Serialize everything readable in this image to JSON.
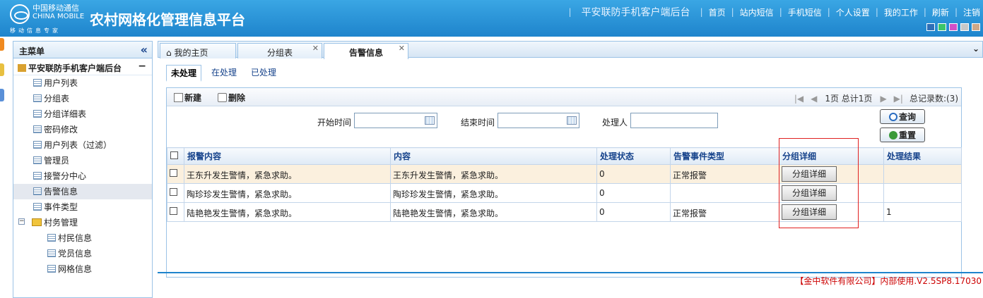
{
  "header": {
    "logo_cn": "中国移动通信",
    "logo_en": "CHINA MOBILE",
    "logo_slogan": "移动信息专家",
    "title": "农村网格化管理信息平台",
    "system_name": "平安联防手机客户端后台",
    "nav": [
      "首页",
      "站内短信",
      "手机短信",
      "个人设置",
      "我的工作",
      "刷新",
      "注销"
    ],
    "theme_colors": [
      "#2f6fb7",
      "#3bc56a",
      "#d050c8",
      "#c8c8c8",
      "#cfa888"
    ]
  },
  "sidebar": {
    "title": "主菜单",
    "collapse_icon": "«",
    "root": "平安联防手机客户端后台",
    "items": [
      "用户列表",
      "分组表",
      "分组详细表",
      "密码修改",
      "用户列表（过滤）",
      "管理员",
      "接警分中心",
      "告警信息",
      "事件类型"
    ],
    "folder": "村务管理",
    "sub_items": [
      "村民信息",
      "党员信息",
      "网格信息"
    ]
  },
  "tabs": [
    {
      "label": "我的主页"
    },
    {
      "label": "分组表"
    },
    {
      "label": "告警信息"
    }
  ],
  "subtabs": [
    "未处理",
    "在处理",
    "已处理"
  ],
  "toolbar": {
    "new": "新建",
    "delete": "删除",
    "pager_text": "1页 总计1页",
    "total": "总记录数:(3)"
  },
  "search": {
    "start_label": "开始时间",
    "end_label": "结束时间",
    "handler_label": "处理人",
    "query": "查询",
    "reset": "重置"
  },
  "table": {
    "headers": [
      "报警内容",
      "内容",
      "处理状态",
      "告警事件类型",
      "分组详细",
      "处理结果"
    ],
    "rows": [
      {
        "alarm": "王东升发生警情，紧急求助。",
        "content": "王东升发生警情，紧急求助。",
        "status": "0",
        "type": "正常报警",
        "btn": "分组详细",
        "result": ""
      },
      {
        "alarm": "陶珍珍发生警情，紧急求助。",
        "content": "陶珍珍发生警情，紧急求助。",
        "status": "0",
        "type": "",
        "btn": "分组详细",
        "result": ""
      },
      {
        "alarm": "陆艳艳发生警情，紧急求助。",
        "content": "陆艳艳发生警情，紧急求助。",
        "status": "0",
        "type": "正常报警",
        "btn": "分组详细",
        "result": "1"
      }
    ]
  },
  "footer": "【金中软件有限公司】内部使用.V2.5SP8.17030"
}
